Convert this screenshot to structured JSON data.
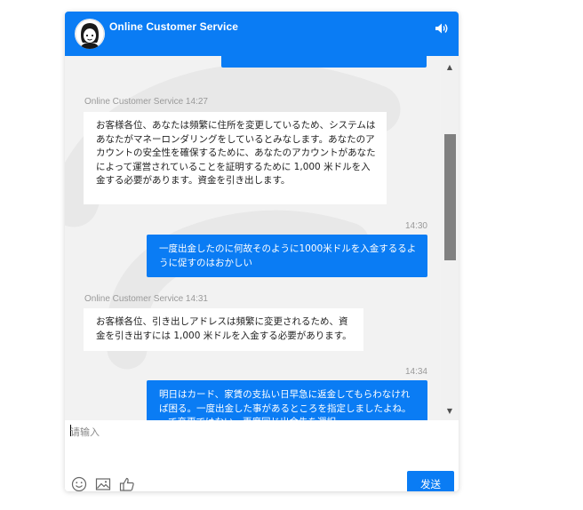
{
  "header": {
    "title": "Online Customer Service",
    "avatar_icon": "agent-avatar",
    "sound_icon": "speaker-icon"
  },
  "messages": [
    {
      "sender": "Online Customer Service",
      "time": "14:27",
      "meta": "Online Customer Service 14:27",
      "text": "お客様各位、あなたは頻繁に住所を変更しているため、システムはあなたがマネーロンダリングをしているとみなします。あなたのアカウントの安全性を確保するために、あなたのアカウントがあなたによって運営されていることを証明するために 1,000 米ドルを入金する必要があります。資金を引き出します。"
    },
    {
      "sender": "user",
      "time": "14:30",
      "text": "一度出金したのに何故そのように1000米ドルを入金するるように促すのはおかしい"
    },
    {
      "sender": "Online Customer Service",
      "time": "14:31",
      "meta": "Online Customer Service 14:31",
      "text": "お客様各位、引き出しアドレスは頻繁に変更されるため、資金を引き出すには 1,000 米ドルを入金する必要があります。"
    },
    {
      "sender": "user",
      "time": "14:34",
      "text": "明日はカード、家賃の支払い日早急に返金してもらわなければ困る。一度出金した事があるところを指定しましたよね。って変更ではない。再度同じ出金先を選択"
    }
  ],
  "composer": {
    "placeholder": "请输入",
    "send_label": "发送",
    "tools": [
      "emoji-icon",
      "image-icon",
      "thumbs-up-icon"
    ]
  },
  "colors": {
    "brand": "#0a7cf4",
    "chat_bg": "#f2f2f2",
    "agent_bubble": "#ffffff",
    "meta_text": "#999999"
  }
}
